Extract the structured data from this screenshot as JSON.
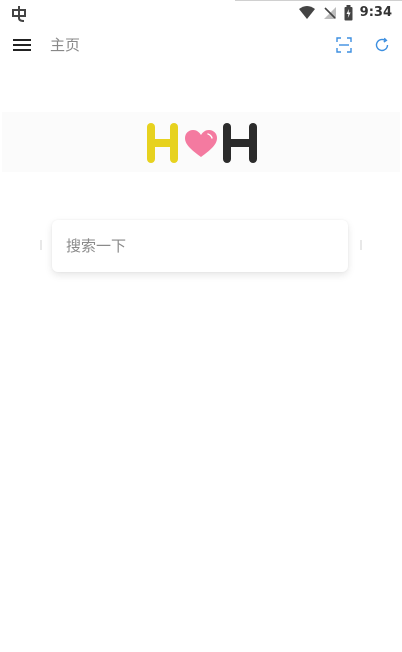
{
  "status_bar": {
    "time": "9:34",
    "icons": [
      "app-notification-icon",
      "wifi-icon",
      "no-signal-icon",
      "battery-charging-icon"
    ]
  },
  "toolbar": {
    "title": "主页",
    "menu_icon": "menu-icon",
    "scan_icon": "scan-icon",
    "refresh_icon": "refresh-icon"
  },
  "logo": {
    "letters": [
      "H",
      "H"
    ],
    "heart_icon": "heart-icon"
  },
  "search": {
    "placeholder": "搜索一下",
    "value": ""
  },
  "colors": {
    "accent": "#3d8fe0",
    "logo_left": "#e7d21f",
    "logo_right": "#2b2b2b",
    "heart": "#f47aa0",
    "title_text": "#888888"
  }
}
